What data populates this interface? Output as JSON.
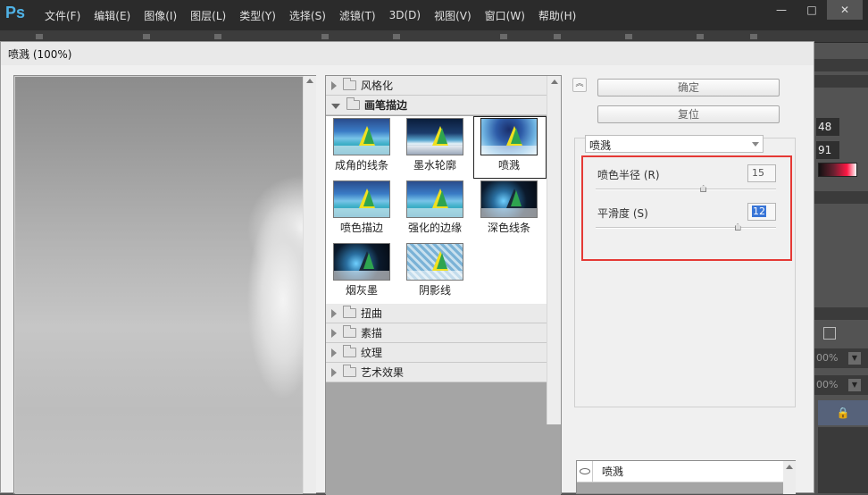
{
  "app": {
    "logo": "Ps",
    "menu": [
      "文件(F)",
      "编辑(E)",
      "图像(I)",
      "图层(L)",
      "类型(Y)",
      "选择(S)",
      "滤镜(T)",
      "3D(D)",
      "视图(V)",
      "窗口(W)",
      "帮助(H)"
    ],
    "window_buttons": [
      "—",
      "□",
      "✕"
    ]
  },
  "right_panel": {
    "field1": "48",
    "field2": "91",
    "select1": "00%",
    "select2": "00%",
    "lock": "🔒"
  },
  "dialog": {
    "title": "喷溅 (100%)",
    "categories_top": [
      {
        "label": "风格化",
        "open": false
      },
      {
        "label": "画笔描边",
        "open": true
      }
    ],
    "thumbnails": [
      {
        "label": "成角的线条",
        "art": "art-sea"
      },
      {
        "label": "墨水轮廓",
        "art": "art-ink"
      },
      {
        "label": "喷溅",
        "art": "art-spray",
        "selected": true
      },
      {
        "label": "喷色描边",
        "art": "art-sea"
      },
      {
        "label": "强化的边缘",
        "art": "art-sea"
      },
      {
        "label": "深色线条",
        "art": "art-dark"
      },
      {
        "label": "烟灰墨",
        "art": "art-dark"
      },
      {
        "label": "阴影线",
        "art": "art-hatch"
      }
    ],
    "categories_bottom": [
      {
        "label": "扭曲"
      },
      {
        "label": "素描"
      },
      {
        "label": "纹理"
      },
      {
        "label": "艺术效果"
      }
    ],
    "buttons": {
      "ok": "确定",
      "reset": "复位"
    },
    "filter_select": "喷溅",
    "params": [
      {
        "label": "喷色半径 (R)",
        "value": "15",
        "slider_fraction": 0.6,
        "focused": false
      },
      {
        "label": "平滑度 (S)",
        "value": "12",
        "slider_fraction": 0.79,
        "focused": true
      }
    ],
    "layers": [
      {
        "name": "喷溅"
      }
    ]
  }
}
